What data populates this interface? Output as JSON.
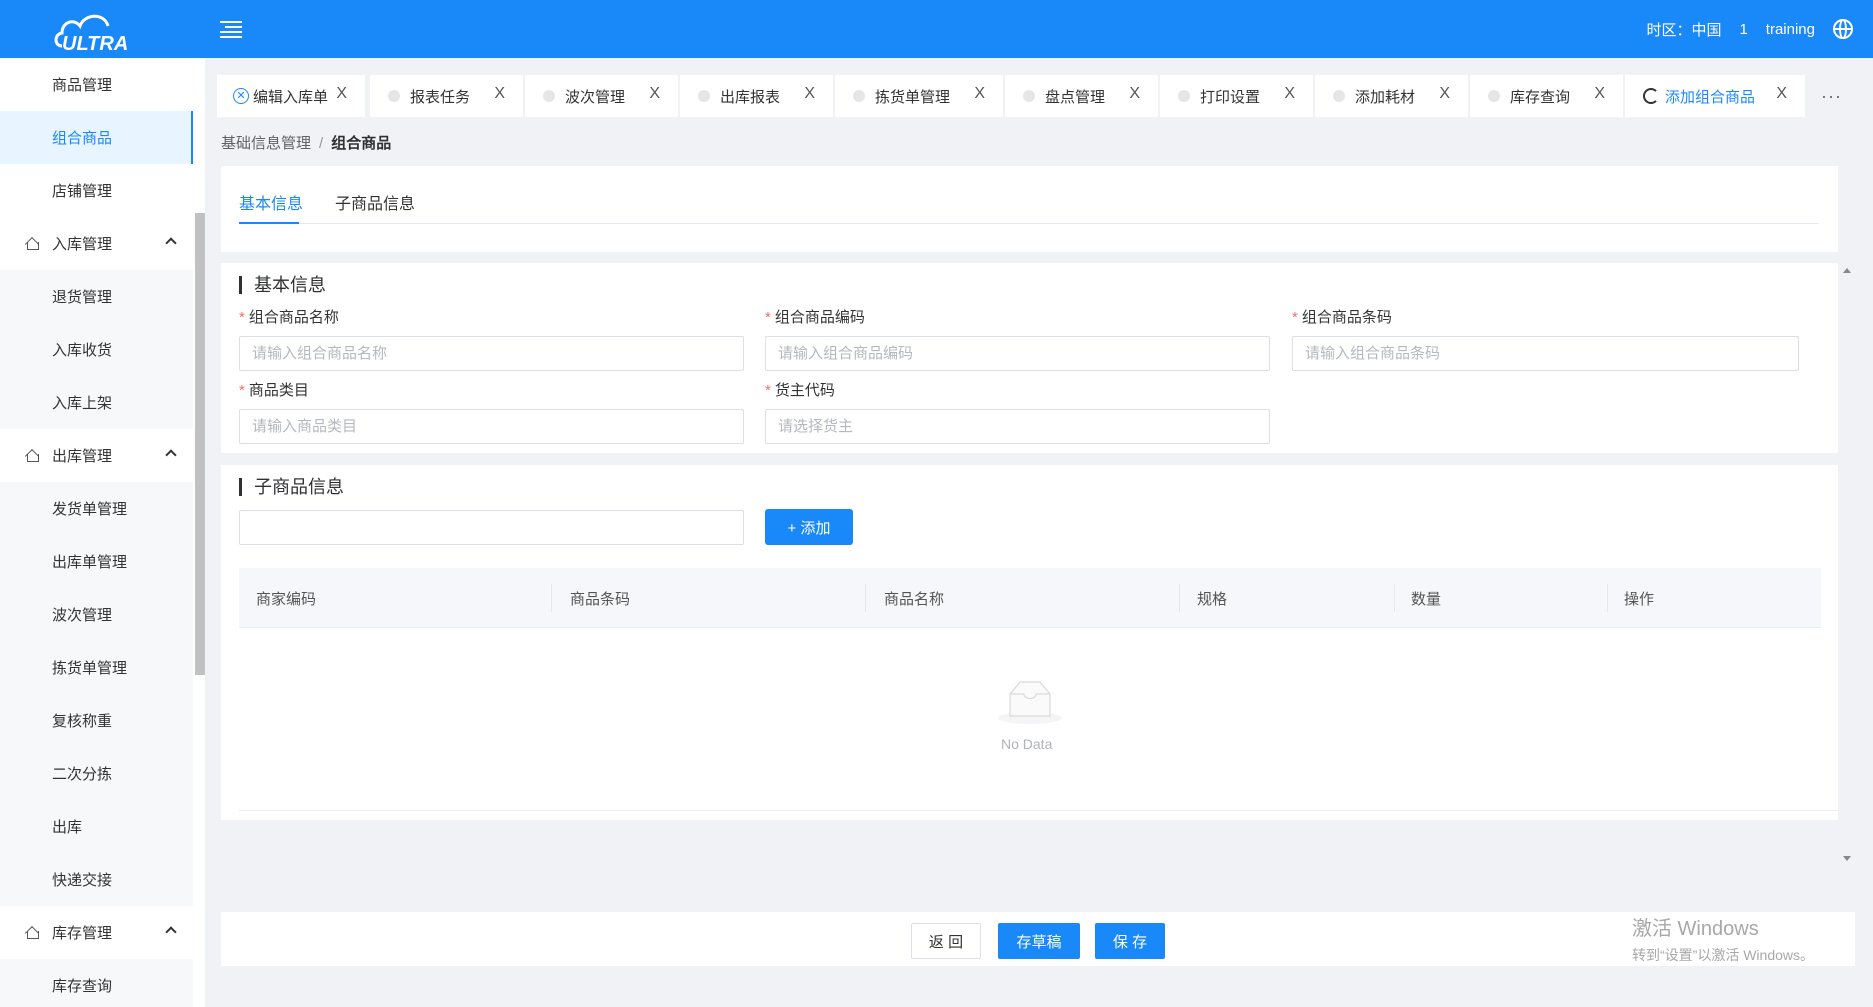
{
  "header": {
    "logo_text": "ULTRA",
    "timezone_label": "时区：中国",
    "badge": "1",
    "user": "training"
  },
  "sidebar": {
    "items": [
      {
        "label": "商品管理",
        "type": "item"
      },
      {
        "label": "组合商品",
        "type": "item",
        "active": true
      },
      {
        "label": "店铺管理",
        "type": "item"
      },
      {
        "label": "入库管理",
        "type": "group"
      },
      {
        "label": "退货管理",
        "type": "sub"
      },
      {
        "label": "入库收货",
        "type": "sub"
      },
      {
        "label": "入库上架",
        "type": "sub"
      },
      {
        "label": "出库管理",
        "type": "group"
      },
      {
        "label": "发货单管理",
        "type": "sub"
      },
      {
        "label": "出库单管理",
        "type": "sub"
      },
      {
        "label": "波次管理",
        "type": "sub"
      },
      {
        "label": "拣货单管理",
        "type": "sub"
      },
      {
        "label": "复核称重",
        "type": "sub"
      },
      {
        "label": "二次分拣",
        "type": "sub"
      },
      {
        "label": "出库",
        "type": "sub"
      },
      {
        "label": "快递交接",
        "type": "sub"
      },
      {
        "label": "库存管理",
        "type": "group"
      },
      {
        "label": "库存查询",
        "type": "sub"
      }
    ]
  },
  "tabs": [
    {
      "label": "编辑入库单"
    },
    {
      "label": "报表任务"
    },
    {
      "label": "波次管理"
    },
    {
      "label": "出库报表"
    },
    {
      "label": "拣货单管理"
    },
    {
      "label": "盘点管理"
    },
    {
      "label": "打印设置"
    },
    {
      "label": "添加耗材"
    },
    {
      "label": "库存查询"
    },
    {
      "label": "添加组合商品",
      "active": true
    }
  ],
  "tab_close": "X",
  "tabs_more": "···",
  "breadcrumb": {
    "parent": "基础信息管理",
    "separator": "/",
    "current": "组合商品"
  },
  "form_tabs": {
    "basic": "基本信息",
    "children": "子商品信息"
  },
  "basic_section": {
    "title": "基本信息",
    "fields": {
      "name": {
        "label": "组合商品名称",
        "placeholder": "请输入组合商品名称"
      },
      "code": {
        "label": "组合商品编码",
        "placeholder": "请输入组合商品编码"
      },
      "barcode": {
        "label": "组合商品条码",
        "placeholder": "请输入组合商品条码"
      },
      "category": {
        "label": "商品类目",
        "placeholder": "请输入商品类目"
      },
      "owner": {
        "label": "货主代码",
        "placeholder": "请选择货主"
      }
    },
    "required_mark": "*"
  },
  "child_section": {
    "title": "子商品信息",
    "search_value": "",
    "add_button": "+ 添加",
    "columns": [
      "商家编码",
      "商品条码",
      "商品名称",
      "规格",
      "数量",
      "操作"
    ],
    "empty_text": "No Data"
  },
  "footer": {
    "back": "返 回",
    "draft": "存草稿",
    "save": "保 存"
  },
  "watermark": {
    "line1": "激活 Windows",
    "line2": "转到“设置”以激活 Windows。"
  }
}
